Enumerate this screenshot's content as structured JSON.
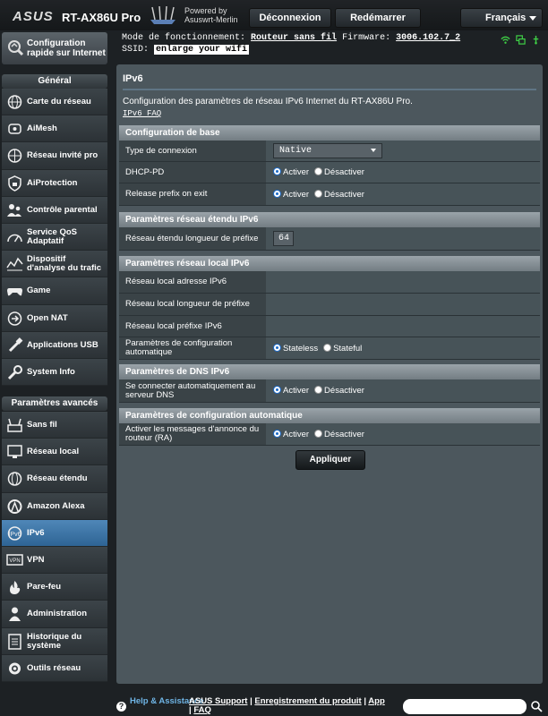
{
  "header": {
    "brand": "ASUS",
    "model": "RT-AX86U Pro",
    "powered_by": "Powered by",
    "firmware_brand": "Asuswrt-Merlin",
    "logout_label": "Déconnexion",
    "reboot_label": "Redémarrer",
    "language": "Français"
  },
  "info": {
    "mode_label": "Mode de fonctionnement:",
    "mode_value": "Routeur sans fil",
    "firmware_label": "Firmware:",
    "firmware_value": "3006.102.7_2",
    "ssid_label": "SSID:",
    "ssid_value": "enlarge your wifi"
  },
  "sidebar": {
    "quick_setup": "Configuration rapide sur Internet",
    "general_header": "Général",
    "general_items": [
      {
        "label": "Carte du réseau",
        "icon": "network-map-icon"
      },
      {
        "label": "AiMesh",
        "icon": "aimesh-icon"
      },
      {
        "label": "Réseau invité pro",
        "icon": "guest-network-icon"
      },
      {
        "label": "AiProtection",
        "icon": "aiprotection-icon"
      },
      {
        "label": "Contrôle parental",
        "icon": "parental-control-icon"
      },
      {
        "label": "Service QoS Adaptatif",
        "icon": "qos-icon"
      },
      {
        "label": "Dispositif d'analyse du trafic",
        "icon": "traffic-analyzer-icon"
      },
      {
        "label": "Game",
        "icon": "game-icon"
      },
      {
        "label": "Open NAT",
        "icon": "open-nat-icon"
      },
      {
        "label": "Applications USB",
        "icon": "usb-icon"
      },
      {
        "label": "System Info",
        "icon": "wrench-icon"
      }
    ],
    "advanced_header": "Paramètres avancés",
    "advanced_items": [
      {
        "label": "Sans fil",
        "icon": "wireless-icon"
      },
      {
        "label": "Réseau local",
        "icon": "lan-icon"
      },
      {
        "label": "Réseau étendu",
        "icon": "wan-icon"
      },
      {
        "label": "Amazon Alexa",
        "icon": "alexa-icon"
      },
      {
        "label": "IPv6",
        "icon": "ipv6-icon"
      },
      {
        "label": "VPN",
        "icon": "vpn-icon"
      },
      {
        "label": "Pare-feu",
        "icon": "firewall-icon"
      },
      {
        "label": "Administration",
        "icon": "administration-icon"
      },
      {
        "label": "Historique du système",
        "icon": "system-log-icon"
      },
      {
        "label": "Outils réseau",
        "icon": "network-tools-icon"
      }
    ],
    "active_item": "IPv6"
  },
  "main": {
    "title": "IPv6",
    "description": "Configuration des paramètres de réseau IPv6 Internet du RT-AX86U Pro.",
    "faq_link": "IPv6 FAQ",
    "radio": {
      "enable": "Activer",
      "disable": "Désactiver",
      "stateless": "Stateless",
      "stateful": "Stateful"
    },
    "basic": {
      "header": "Configuration de base",
      "connection_type_label": "Type de connexion",
      "connection_type_value": "Native",
      "dhcp_pd_label": "DHCP-PD",
      "release_prefix_label": "Release prefix on exit"
    },
    "wan": {
      "header": "Paramètres réseau étendu IPv6",
      "prefix_length_label": "Réseau étendu longueur de préfixe",
      "prefix_length_value": "64"
    },
    "lan": {
      "header": "Paramètres réseau local IPv6",
      "address_label": "Réseau local adresse IPv6",
      "prefix_length_label": "Réseau local longueur de préfixe",
      "prefix_label": "Réseau local préfixe IPv6",
      "autoconfig_label": "Paramètres de configuration automatique"
    },
    "dns": {
      "header": "Paramètres de DNS IPv6",
      "auto_connect_label": "Se connecter automatiquement au serveur DNS"
    },
    "autoconfig": {
      "header": "Paramètres de configuration automatique",
      "ra_label": "Activer les messages d'annonce du routeur (RA)"
    },
    "apply_label": "Appliquer"
  },
  "footer": {
    "help": "Help & Assistance",
    "support": "ASUS Support",
    "registration": "Enregistrement du produit",
    "app": "App",
    "faq": "FAQ"
  }
}
